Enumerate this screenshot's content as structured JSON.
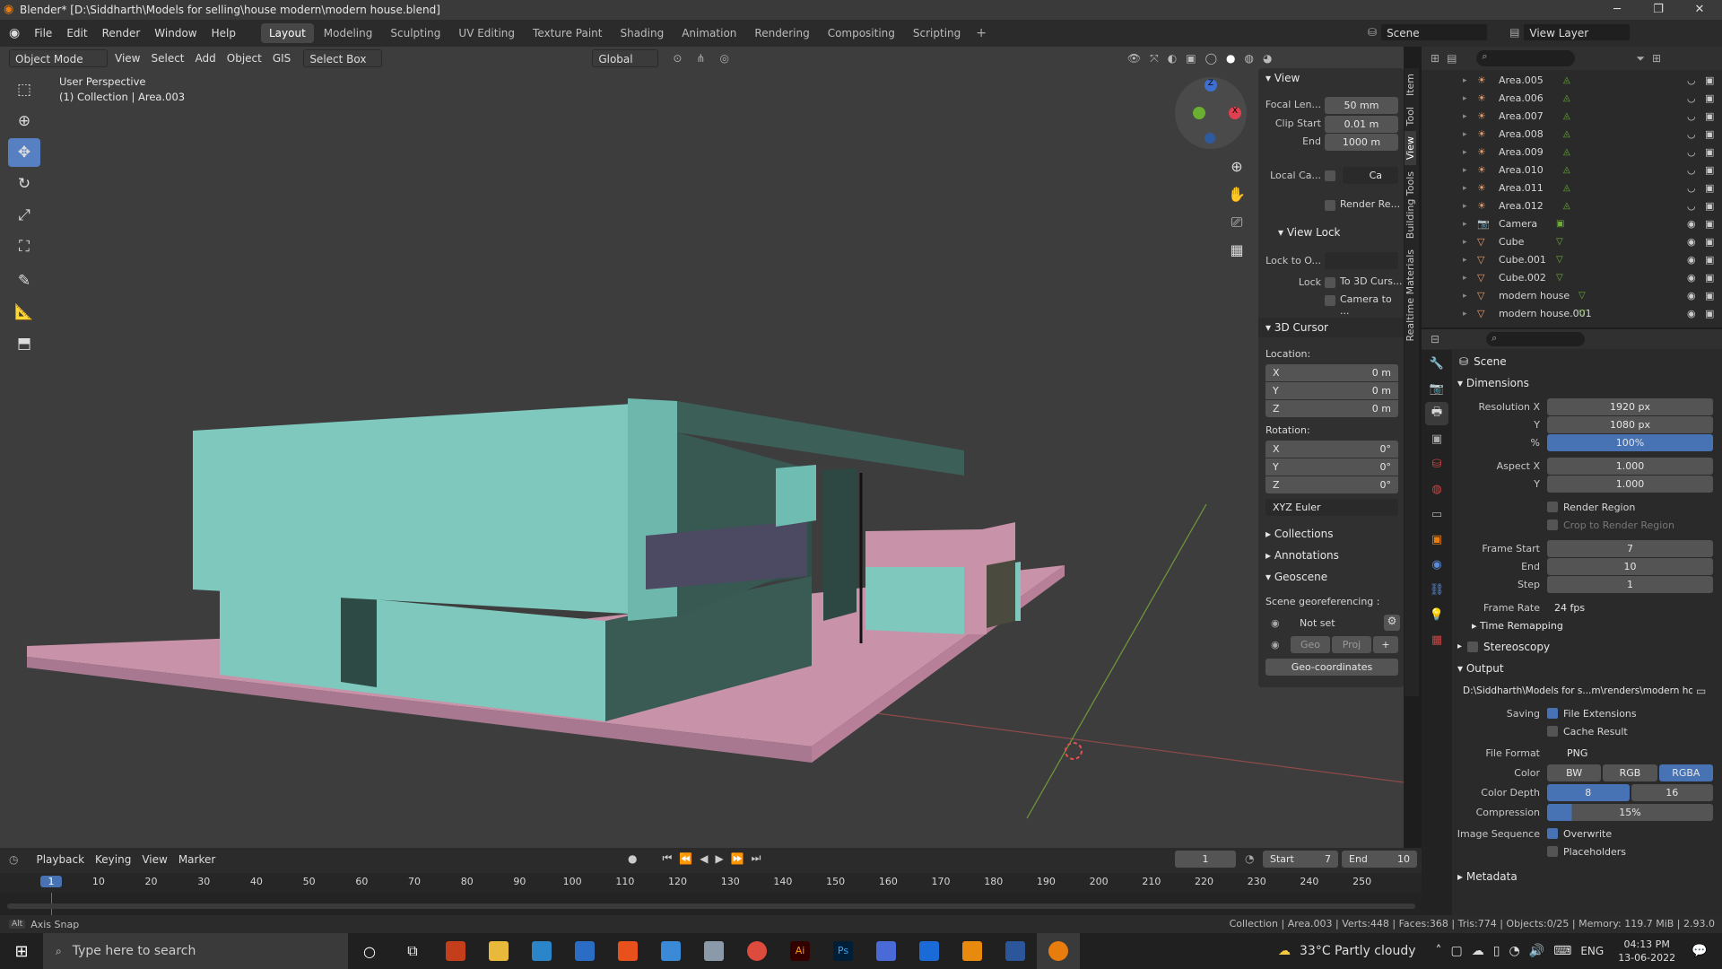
{
  "window": {
    "title": "Blender* [D:\\Siddharth\\Models for selling\\house modern\\modern house.blend]"
  },
  "menu": [
    "File",
    "Edit",
    "Render",
    "Window",
    "Help"
  ],
  "workspaces": [
    "Layout",
    "Modeling",
    "Sculpting",
    "UV Editing",
    "Texture Paint",
    "Shading",
    "Animation",
    "Rendering",
    "Compositing",
    "Scripting"
  ],
  "active_workspace": "Layout",
  "scene_label": "Scene",
  "viewlayer_label": "View Layer",
  "vp_header": {
    "mode": "Object Mode",
    "view": "View",
    "select": "Select",
    "add": "Add",
    "object": "Object",
    "gis": "GIS",
    "select_box": "Select Box",
    "orientation": "Global"
  },
  "viewport": {
    "perspective": "User Perspective",
    "context": "(1) Collection | Area.003"
  },
  "npanel": {
    "view_title": "View",
    "focal_label": "Focal Len...",
    "focal_value": "50 mm",
    "clip_start_label": "Clip Start",
    "clip_start_value": "0.01 m",
    "clip_end_label": "End",
    "clip_end_value": "1000 m",
    "local_camera_label": "Local Ca...",
    "local_camera_value": "Ca",
    "render_region_label": "Render Re...",
    "view_lock_title": "View Lock",
    "lock_to_obj_label": "Lock to O...",
    "lock_label": "Lock",
    "lock_cursor": "To 3D Curs...",
    "camera_to": "Camera to ...",
    "cursor_title": "3D Cursor",
    "location_label": "Location:",
    "loc": [
      {
        "axis": "X",
        "value": "0 m"
      },
      {
        "axis": "Y",
        "value": "0 m"
      },
      {
        "axis": "Z",
        "value": "0 m"
      }
    ],
    "rotation_label": "Rotation:",
    "rot": [
      {
        "axis": "X",
        "value": "0°"
      },
      {
        "axis": "Y",
        "value": "0°"
      },
      {
        "axis": "Z",
        "value": "0°"
      }
    ],
    "rot_mode": "XYZ Euler",
    "collections": "Collections",
    "annotations": "Annotations",
    "geoscene": "Geoscene",
    "georef_label": "Scene georeferencing :",
    "not_set": "Not set",
    "geo": "Geo",
    "proj": "Proj",
    "geo_coords": "Geo-coordinates"
  },
  "side_tabs": [
    "Item",
    "Tool",
    "View",
    "Building Tools",
    "Realtime Materials"
  ],
  "active_side_tab": "View",
  "outliner": [
    {
      "name": "Area.005",
      "kind": "light"
    },
    {
      "name": "Area.006",
      "kind": "light"
    },
    {
      "name": "Area.007",
      "kind": "light"
    },
    {
      "name": "Area.008",
      "kind": "light"
    },
    {
      "name": "Area.009",
      "kind": "light"
    },
    {
      "name": "Area.010",
      "kind": "light"
    },
    {
      "name": "Area.011",
      "kind": "light"
    },
    {
      "name": "Area.012",
      "kind": "light"
    },
    {
      "name": "Camera",
      "kind": "camera"
    },
    {
      "name": "Cube",
      "kind": "mesh"
    },
    {
      "name": "Cube.001",
      "kind": "mesh"
    },
    {
      "name": "Cube.002",
      "kind": "mesh"
    },
    {
      "name": "modern house",
      "kind": "mesh"
    },
    {
      "name": "modern house.001",
      "kind": "mesh"
    }
  ],
  "props": {
    "scene": "Scene",
    "dimensions": "Dimensions",
    "res_x_label": "Resolution X",
    "res_x": "1920 px",
    "res_y_label": "Y",
    "res_y": "1080 px",
    "pct_label": "%",
    "pct": "100%",
    "aspect_x_label": "Aspect X",
    "aspect_x": "1.000",
    "aspect_y_label": "Y",
    "aspect_y": "1.000",
    "render_region": "Render Region",
    "crop": "Crop to Render Region",
    "frame_start_label": "Frame Start",
    "frame_start": "7",
    "end_label": "End",
    "end": "10",
    "step_label": "Step",
    "step": "1",
    "frame_rate_label": "Frame Rate",
    "frame_rate": "24 fps",
    "time_remap": "Time Remapping",
    "stereoscopy": "Stereoscopy",
    "output": "Output",
    "output_path": "D:\\Siddharth\\Models for s...m\\renders\\modern house",
    "saving_label": "Saving",
    "file_ext": "File Extensions",
    "cache": "Cache Result",
    "file_format_label": "File Format",
    "file_format": "PNG",
    "color_label": "Color",
    "color_opts": [
      "BW",
      "RGB",
      "RGBA"
    ],
    "depth_label": "Color Depth",
    "depth_opts": [
      "8",
      "16"
    ],
    "compression_label": "Compression",
    "compression": "15%",
    "image_seq_label": "Image Sequence",
    "overwrite": "Overwrite",
    "placeholders": "Placeholders",
    "metadata": "Metadata"
  },
  "timeline": {
    "menus": [
      "Playback",
      "Keying",
      "View",
      "Marker"
    ],
    "current": "1",
    "start_label": "Start",
    "start": "7",
    "end_label": "End",
    "end": "10",
    "ticks": [
      "1",
      "10",
      "20",
      "30",
      "40",
      "50",
      "60",
      "70",
      "80",
      "90",
      "100",
      "110",
      "120",
      "130",
      "140",
      "150",
      "160",
      "170",
      "180",
      "190",
      "200",
      "210",
      "220",
      "230",
      "240",
      "250"
    ]
  },
  "status": {
    "left": "Axis Snap",
    "right": "Collection | Area.003 | Verts:448 | Faces:368 | Tris:774 | Objects:0/25 | Memory: 119.7 MiB | 2.93.0"
  },
  "taskbar": {
    "search_placeholder": "Type here to search",
    "weather": "33°C  Partly cloudy",
    "lang": "ENG",
    "time": "04:13 PM",
    "date": "13-06-2022"
  },
  "colors": {
    "accent": "#4772b3",
    "house_teal": "#7fc8be",
    "house_pink": "#c98fa8",
    "viewport_bg": "#3d3d3d"
  }
}
